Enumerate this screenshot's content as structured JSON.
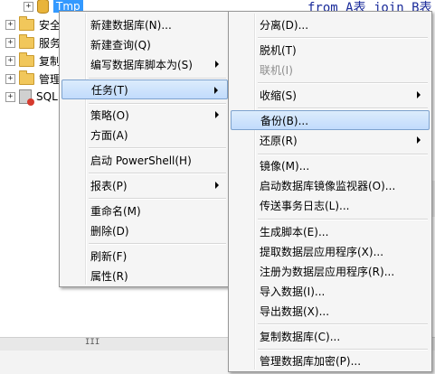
{
  "tree": {
    "items": [
      {
        "label": "Tmp",
        "selected": true
      },
      {
        "label": "安全"
      },
      {
        "label": "服务"
      },
      {
        "label": "复制"
      },
      {
        "label": "管理"
      },
      {
        "label": "SQL"
      }
    ]
  },
  "editor": {
    "code_line": "from A表 join B表"
  },
  "hscroll": {
    "grip": "III"
  },
  "main_menu": {
    "items": [
      {
        "label": "新建数据库(N)..."
      },
      {
        "label": "新建查询(Q)"
      },
      {
        "label": "编写数据库脚本为(S)",
        "submenu": true
      },
      {
        "label": "任务(T)",
        "submenu": true,
        "highlighted": true
      },
      {
        "label": "策略(O)",
        "submenu": true
      },
      {
        "label": "方面(A)"
      },
      {
        "label": "启动 PowerShell(H)"
      },
      {
        "label": "报表(P)",
        "submenu": true
      },
      {
        "label": "重命名(M)"
      },
      {
        "label": "删除(D)"
      },
      {
        "label": "刷新(F)"
      },
      {
        "label": "属性(R)"
      }
    ]
  },
  "tasks_menu": {
    "items": [
      {
        "label": "分离(D)..."
      },
      {
        "label": "脱机(T)"
      },
      {
        "label": "联机(I)",
        "disabled": true
      },
      {
        "label": "收缩(S)",
        "submenu": true
      },
      {
        "label": "备份(B)...",
        "highlighted": true
      },
      {
        "label": "还原(R)",
        "submenu": true
      },
      {
        "label": "镜像(M)..."
      },
      {
        "label": "启动数据库镜像监视器(O)..."
      },
      {
        "label": "传送事务日志(L)..."
      },
      {
        "label": "生成脚本(E)..."
      },
      {
        "label": "提取数据层应用程序(X)..."
      },
      {
        "label": "注册为数据层应用程序(R)..."
      },
      {
        "label": "导入数据(I)..."
      },
      {
        "label": "导出数据(X)..."
      },
      {
        "label": "复制数据库(C)..."
      },
      {
        "label": "管理数据库加密(P)..."
      }
    ]
  }
}
